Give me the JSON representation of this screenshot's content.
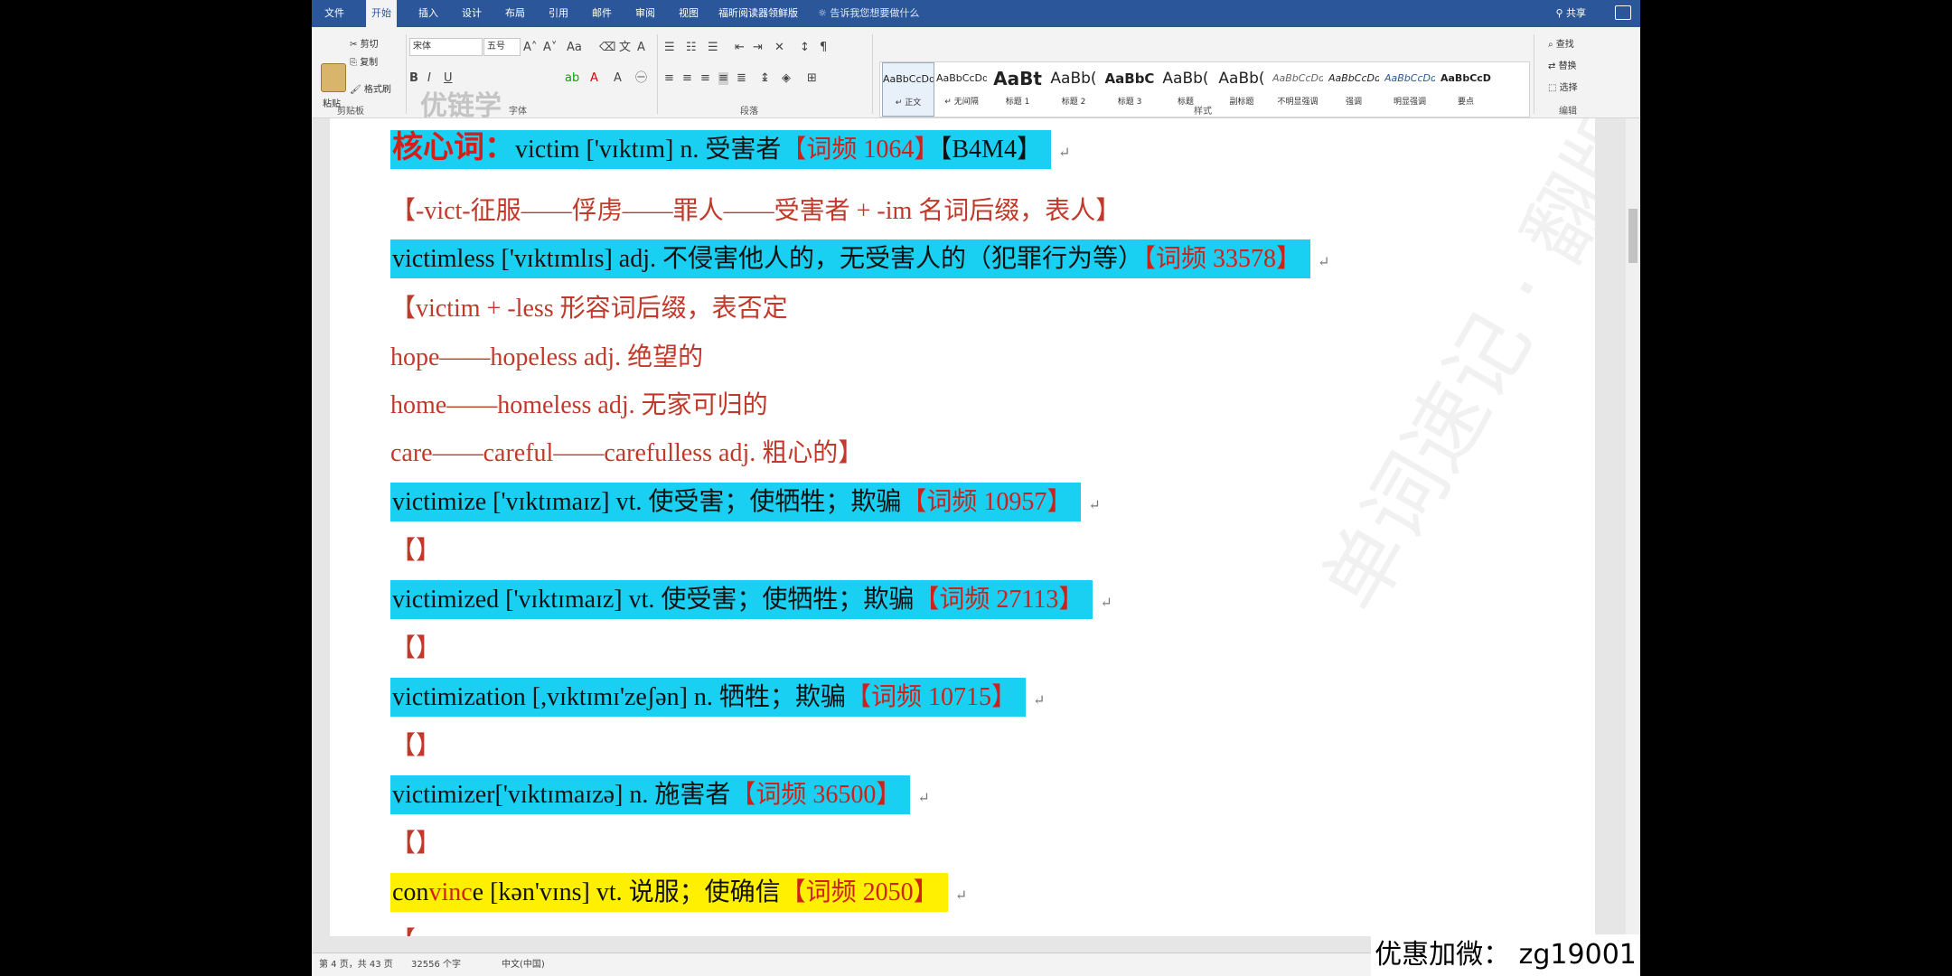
{
  "tabs": [
    "文件",
    "开始",
    "插入",
    "设计",
    "布局",
    "引用",
    "邮件",
    "审阅",
    "视图",
    "福昕阅读器领鲜版"
  ],
  "tell_me": "告诉我您想要做什么",
  "share": "共享",
  "ribbon": {
    "clipboard": {
      "paste": "粘贴",
      "cut": "剪切",
      "copy": "复制",
      "format_painter": "格式刷",
      "label": "剪贴板"
    },
    "font": {
      "name": "宋体",
      "size": "五号",
      "label": "字体"
    },
    "paragraph_label": "段落",
    "styles": [
      {
        "sample": "AaBbCcDd",
        "name": "↵ 正文"
      },
      {
        "sample": "AaBbCcDd",
        "name": "↵ 无间隔"
      },
      {
        "sample": "AaBt",
        "name": "标题 1"
      },
      {
        "sample": "AaBb(",
        "name": "标题 2"
      },
      {
        "sample": "AaBbC",
        "name": "标题 3"
      },
      {
        "sample": "AaBb(",
        "name": "标题"
      },
      {
        "sample": "AaBb(",
        "name": "副标题"
      },
      {
        "sample": "AaBbCcDd",
        "name": "不明显强调"
      },
      {
        "sample": "AaBbCcDd",
        "name": "强调"
      },
      {
        "sample": "AaBbCcDd",
        "name": "明显强调"
      },
      {
        "sample": "AaBbCcDd",
        "name": "要点"
      }
    ],
    "styles_label": "样式",
    "editing": {
      "find": "查找",
      "replace": "替换",
      "select": "选择",
      "label": "编辑"
    }
  },
  "watermark_logo": "优链学",
  "watermark_diag": "单词速记 · 翻版必究",
  "doc": {
    "core_label": "核心词：",
    "l1_a": "victim ['vɪktɪm] n.  受害者",
    "l1_b": "【词频 1064】",
    "l1_c": "【B4M4】",
    "l2": "【-vict-征服——俘虏——罪人——受害者  + -im 名词后缀，表人】",
    "l3_a": "victimless ['vɪktɪmlɪs] adj.  不侵害他人的，无受害人的（犯罪行为等）",
    "l3_b": "【词频 33578】",
    "l4": "【victim + -less 形容词后缀，表否定",
    "l5": "hope——hopeless adj.  绝望的",
    "l6": "home——homeless adj.  无家可归的",
    "l7": "care——careful——carefulless adj.  粗心的】",
    "l8_a": "victimize ['vɪktɪmaɪz] vt.  使受害；使牺牲；欺骗",
    "l8_b": "【词频 10957】",
    "l9": "【】",
    "l10_a": "victimized ['vɪktɪmaɪz] vt.  使受害；使牺牲；欺骗",
    "l10_b": "【词频 27113】",
    "l11": "【】",
    "l12_a": "victimization [,vɪktɪmɪ'zeʃən] n.  牺牲；欺骗",
    "l12_b": "【词频 10715】",
    "l13": "【】",
    "l14_a": "victimizer['vɪktɪmaɪzə] n.  施害者",
    "l14_b": "【词频 36500】",
    "l15": "【】",
    "l16_pre": "con",
    "l16_root": "vinc",
    "l16_post": "e [kən'vɪns] vt.  说服；使确信",
    "l16_b": "【词频 2050】",
    "l17": "【"
  },
  "status": {
    "page": "第 4 页，共 43 页",
    "words": "32556 个字",
    "lang": "中文(中国)"
  },
  "promo": "优惠加微：  zg19001",
  "colors": {
    "cyan_highlight": "#19d0f2",
    "yellow_highlight": "#ffef00",
    "red_text": "#d0201a",
    "ribbon_blue": "#2b579a"
  }
}
